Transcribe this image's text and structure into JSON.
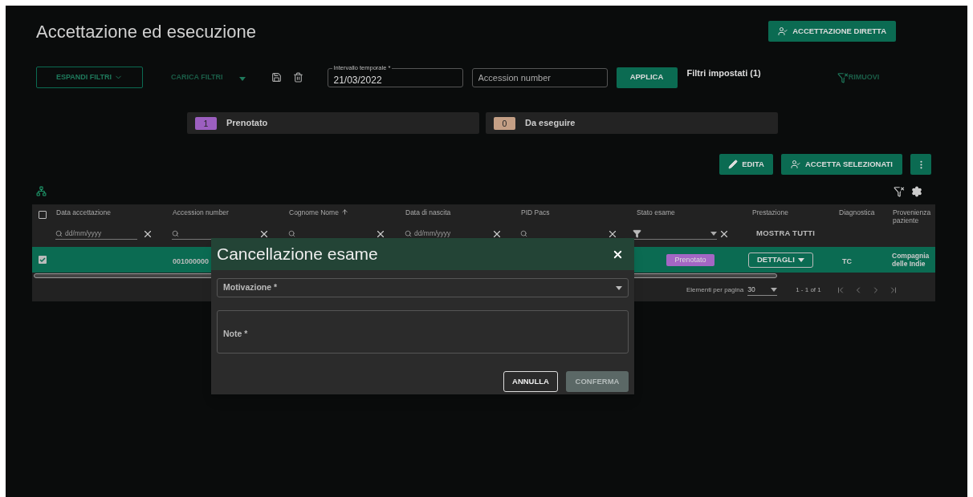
{
  "page": {
    "title": "Accettazione ed esecuzione",
    "primary_action": "ACCETTAZIONE DIRETTA"
  },
  "filters": {
    "expand": "ESPANDI FILTRI",
    "load": "CARICA FILTRI",
    "date_range": {
      "label": "Intervallo temporale *",
      "value": "21/03/2022"
    },
    "accession": {
      "placeholder": "Accession number"
    },
    "apply": "APPLICA",
    "active": "Filtri impostati (1)",
    "remove": "RIMUOVI"
  },
  "status_cards": [
    {
      "count": "1",
      "label": "Prenotato",
      "color": "#9c5fc0"
    },
    {
      "count": "0",
      "label": "Da eseguire",
      "color": "#c49f85"
    }
  ],
  "actions": [
    {
      "kind": "edit",
      "label": "EDITA"
    },
    {
      "kind": "accept",
      "label": "ACCETTA SELEZIONATI"
    },
    {
      "kind": "more"
    }
  ],
  "table": {
    "select_all": false,
    "columns": [
      {
        "label": "Data accettazione",
        "sorted": false,
        "filter": {
          "kind": "date",
          "placeholder": "dd/mm/yyyy"
        }
      },
      {
        "label": "Accession number",
        "sorted": false,
        "filter": {
          "kind": "search"
        }
      },
      {
        "label": "Cognome Nome",
        "sorted": true,
        "filter": {
          "kind": "search"
        }
      },
      {
        "label": "Data di nascita",
        "sorted": false,
        "filter": {
          "kind": "date",
          "placeholder": "dd/mm/yyyy"
        }
      },
      {
        "label": "PID Pacs",
        "sorted": false,
        "filter": {
          "kind": "search"
        }
      },
      {
        "label": "Stato esame",
        "sorted": false,
        "filter": {
          "kind": "select"
        }
      },
      {
        "label": "Prestazione",
        "sorted": false,
        "filter": {
          "kind": "button",
          "button": "MOSTRA TUTTI"
        }
      },
      {
        "label": "Diagnostica",
        "sorted": false
      },
      {
        "label": "Provenienza paziente",
        "sorted": false
      }
    ],
    "rows": [
      {
        "selected": true,
        "accession_number": "001000000",
        "status": {
          "label": "Prenotato",
          "color": "#a466c4"
        },
        "service": "DETTAGLI",
        "diagnostics": "TC",
        "origin": "Compagnia delle Indie"
      }
    ],
    "footer": {
      "page_size_label": "Elementi per pagina",
      "page_size": "30",
      "range": "1 - 1 of 1"
    }
  },
  "dialog": {
    "title": "Cancellazione esame",
    "fields": [
      {
        "kind": "select",
        "label": "Motivazione *"
      },
      {
        "kind": "textarea",
        "label": "Note *"
      }
    ],
    "buttons": [
      {
        "label": "ANNULLA",
        "disabled": false
      },
      {
        "label": "CONFERMA",
        "disabled": true
      }
    ]
  }
}
